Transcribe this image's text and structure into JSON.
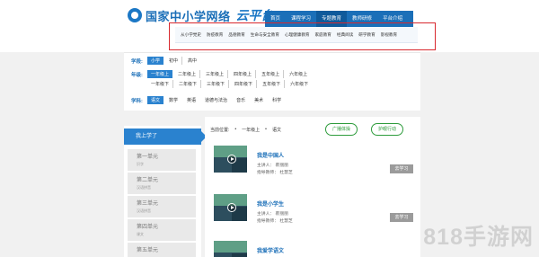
{
  "header": {
    "site_title": "国家中小学网络",
    "site_script": "云平台"
  },
  "nav": {
    "items": [
      "首页",
      "课程学习",
      "专题教育",
      "教师研修",
      "平台介绍"
    ],
    "active": "专题教育"
  },
  "subnav": {
    "items": [
      "从小学党史",
      "防疫教育",
      "品德教育",
      "生命与安全教育",
      "心理健康教育",
      "家庭教育",
      "经典阅读",
      "研学教育",
      "影视教育"
    ]
  },
  "filter": {
    "stage_label": "学段:",
    "stages": [
      "小学",
      "初中",
      "高中"
    ],
    "grade_label": "年级:",
    "grades_row1": [
      "一年级上",
      "二年级上",
      "三年级上",
      "四年级上",
      "五年级上",
      "六年级上"
    ],
    "grades_row2": [
      "一年级下",
      "二年级下",
      "三年级下",
      "四年级下",
      "五年级下",
      "六年级下"
    ],
    "subject_label": "学科:",
    "subjects": [
      "语文",
      "数学",
      "英语",
      "道德与法治",
      "音乐",
      "美术",
      "科学"
    ]
  },
  "units": {
    "header": "我上学了",
    "items": [
      {
        "name": "第一单元",
        "sub": "识字"
      },
      {
        "name": "第二单元",
        "sub": "汉语拼音"
      },
      {
        "name": "第三单元",
        "sub": "汉语拼音"
      },
      {
        "name": "第四单元",
        "sub": "课文"
      },
      {
        "name": "第五单元",
        "sub": ""
      }
    ]
  },
  "content": {
    "crumb_label": "当前位置:",
    "crumb_grade": "一年级上",
    "crumb_subject": "语文",
    "pill_1": "广播体操",
    "pill_2": "护眼行动",
    "lessons": [
      {
        "title": "我是中国人",
        "speaker": "主讲人：  裹丽丽",
        "guide": "指导教师：  杜慧芝",
        "button": "去学习"
      },
      {
        "title": "我是小学生",
        "speaker": "主讲人：  裹丽丽",
        "guide": "指导教师：  杜慧芝",
        "button": "去学习"
      },
      {
        "title": "我爱学语文",
        "speaker": "",
        "guide": "",
        "button": ""
      }
    ]
  },
  "watermark": "818手游网"
}
